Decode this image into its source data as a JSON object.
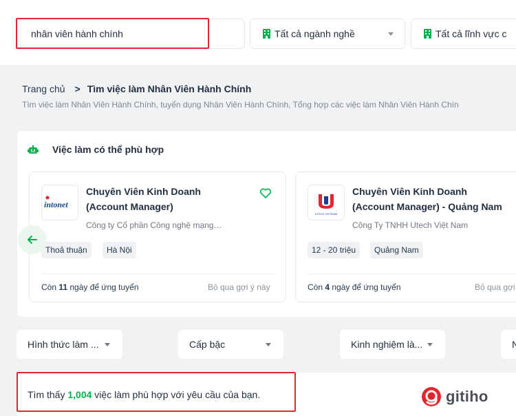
{
  "search": {
    "value": "nhân viên hành chính",
    "industry_label": "Tất cả ngành nghề",
    "field_label": "Tất cả lĩnh vực c"
  },
  "breadcrumb": {
    "home": "Trang chủ",
    "separator": ">",
    "current": "Tìm việc làm Nhân Viên Hành Chính",
    "description": "Tìm việc làm Nhân Viên Hành Chính, tuyển dụng Nhân Viên Hành Chính, Tổng hợp các việc làm Nhân Viên Hành Chín"
  },
  "suggestions": {
    "title": "Việc làm có thể phù hợp",
    "cards": [
      {
        "title_line1": "Chuyên Viên Kinh Doanh",
        "title_line2": "(Account Manager)",
        "company": "Công ty Cổ phần Công nghệ mạng…",
        "logo_text": "intonet",
        "tags": [
          "Thoả thuận",
          "Hà Nội"
        ],
        "deadline_prefix": "Còn ",
        "deadline_days": "11",
        "deadline_suffix": " ngày để ứng tuyển",
        "skip_label": "Bỏ qua gợi ý này"
      },
      {
        "title_line1": "Chuyên Viên Kinh Doanh",
        "title_line2": "(Account Manager) - Quảng Nam",
        "company": "Công Ty TNHH Utech Việt Nam",
        "logo_text": "UTECH VIETNAM",
        "tags": [
          "12 - 20 triệu",
          "Quảng Nam"
        ],
        "deadline_prefix": "Còn ",
        "deadline_days": "4",
        "deadline_suffix": " ngày để ứng tuyển",
        "skip_label": "Bỏ qua gợi"
      }
    ]
  },
  "filters": {
    "work_type": "Hình thức làm ...",
    "level": "Cấp bậc",
    "experience": "Kinh nghiệm là...",
    "more": "N"
  },
  "result": {
    "prefix": "Tìm thấy ",
    "count": "1,004",
    "suffix": " việc làm phù hợp với yêu cầu của bạn."
  },
  "watermark": {
    "text": "gitiho"
  },
  "colors": {
    "brand_green": "#00b14f",
    "highlight_red": "#e1262d"
  }
}
